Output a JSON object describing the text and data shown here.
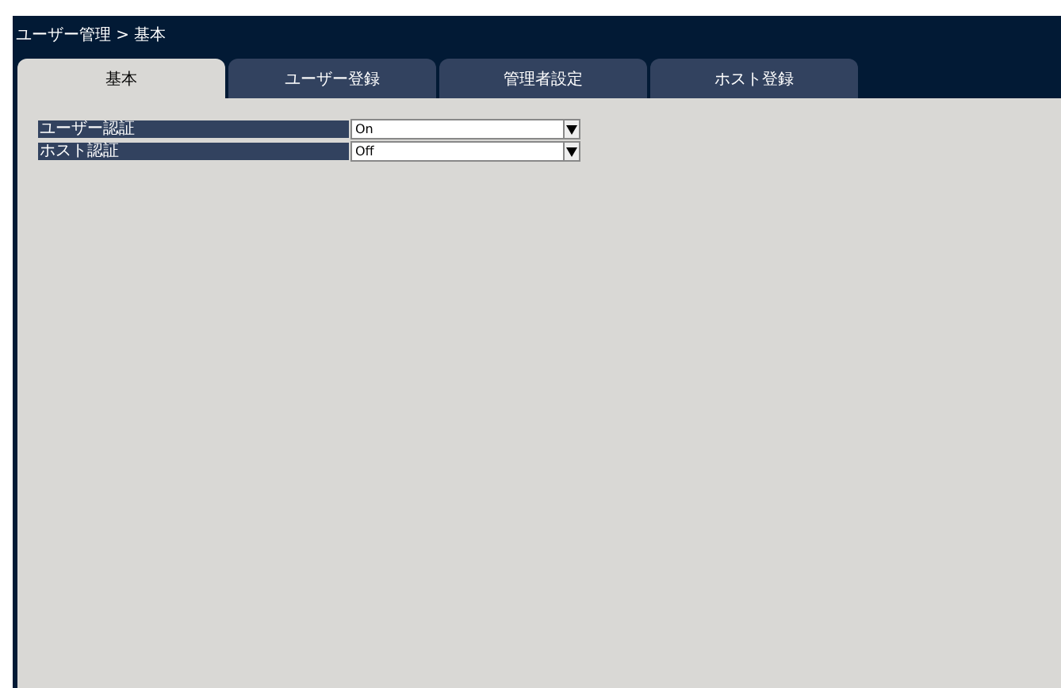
{
  "window": {
    "title": "ユーザー管理 > 基本"
  },
  "tabs": [
    {
      "label": "基本",
      "selected": true
    },
    {
      "label": "ユーザー登録",
      "selected": false
    },
    {
      "label": "管理者設定",
      "selected": false
    },
    {
      "label": "ホスト登録",
      "selected": false
    }
  ],
  "settings": [
    {
      "label": "ユーザー認証",
      "value": "On"
    },
    {
      "label": "ホスト認証",
      "value": "Off"
    }
  ]
}
